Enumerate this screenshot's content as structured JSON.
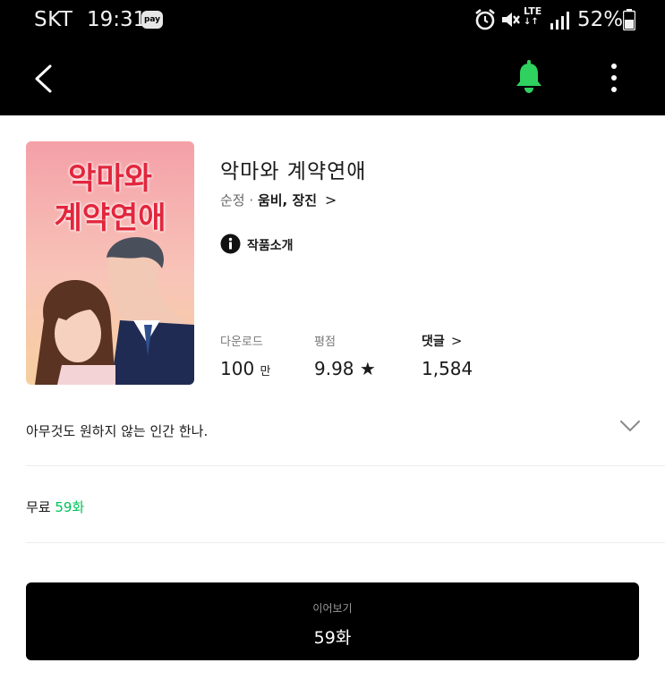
{
  "status_bar": {
    "carrier": "SKT",
    "time": "19:31",
    "pay_badge": "pay",
    "network": "LTE",
    "battery": "52%"
  },
  "app_bar": {
    "icons": [
      "back-icon",
      "bell-icon",
      "more-vertical-icon"
    ],
    "bell_color": "#2fd25f"
  },
  "work": {
    "cover_title_line1": "악마와",
    "cover_title_line2": "계약연애",
    "title": "악마와 계약연애",
    "genre": "순정",
    "separator": "·",
    "authors": "움비, 장진",
    "intro_label": "작품소개",
    "synopsis": "아무것도 원하지 않는 인간 한나."
  },
  "stats": {
    "downloads_label": "다운로드",
    "downloads_value": "100",
    "downloads_unit": "만",
    "rating_label": "평점",
    "rating_value": "9.98",
    "rating_star": "★",
    "comments_label": "댓글",
    "comments_value": "1,584"
  },
  "free": {
    "label": "무료",
    "count": "59화"
  },
  "continue_button": {
    "label": "이어보기",
    "episode": "59화"
  },
  "colors": {
    "accent_green": "#00c35a",
    "bar_background": "#000000"
  }
}
